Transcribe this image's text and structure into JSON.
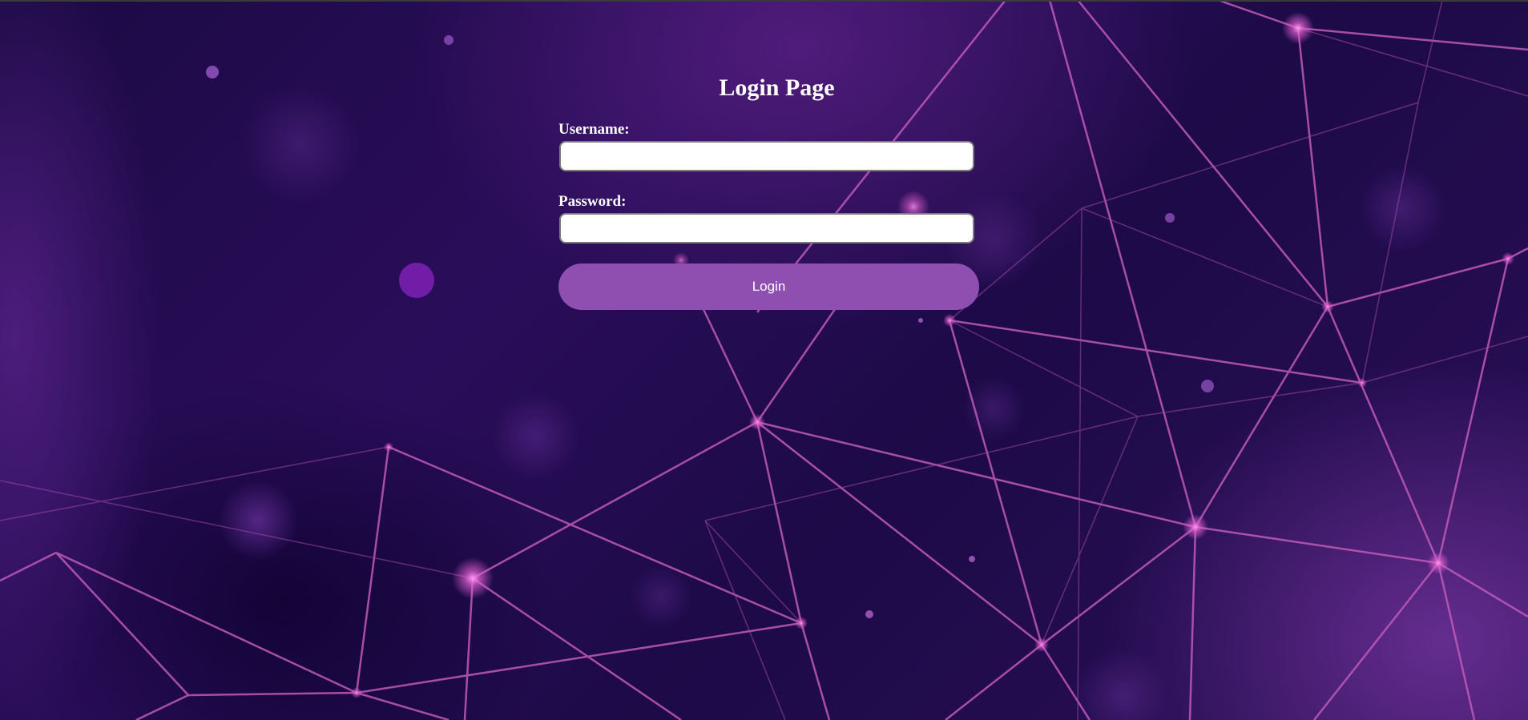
{
  "page": {
    "title": "Login Page"
  },
  "form": {
    "username_label": "Username:",
    "username_value": "",
    "password_label": "Password:",
    "password_value": "",
    "login_button_label": "Login"
  },
  "colors": {
    "button": "#8e4fb0",
    "background": "#1c0a44",
    "network_lines": "#c05ab8",
    "text": "#ffffff"
  }
}
